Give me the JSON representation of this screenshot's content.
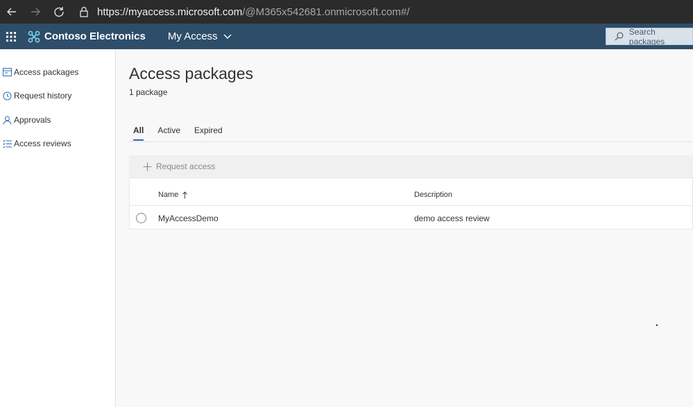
{
  "browser": {
    "url_host": "https://myaccess.microsoft.com",
    "url_path": "/@M365x542681.onmicrosoft.com#/"
  },
  "header": {
    "brand": "Contoso Electronics",
    "app_name": "My Access",
    "search_placeholder": "Search packages",
    "bg_color": "#2e4d69"
  },
  "sidebar": {
    "items": [
      {
        "label": "Access packages",
        "icon": "package-icon"
      },
      {
        "label": "Request history",
        "icon": "history-icon"
      },
      {
        "label": "Approvals",
        "icon": "person-icon"
      },
      {
        "label": "Access reviews",
        "icon": "checklist-icon"
      }
    ]
  },
  "main": {
    "title": "Access packages",
    "count": "1 package",
    "tabs": [
      {
        "label": "All",
        "active": true
      },
      {
        "label": "Active",
        "active": false
      },
      {
        "label": "Expired",
        "active": false
      }
    ],
    "command": {
      "label": "Request access"
    },
    "table": {
      "columns": [
        "Name",
        "Description"
      ],
      "rows": [
        {
          "name": "MyAccessDemo",
          "description": "demo access review"
        }
      ]
    }
  }
}
